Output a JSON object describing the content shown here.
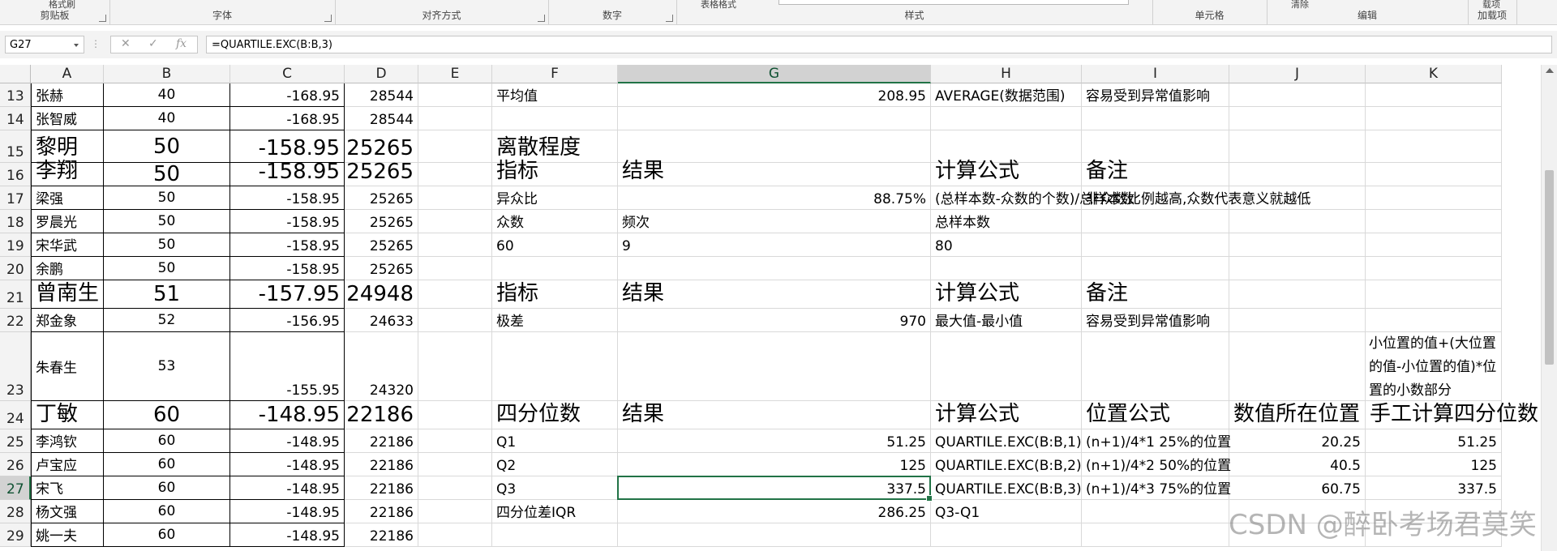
{
  "ribbon": {
    "groups": [
      "剪贴板",
      "字体",
      "对齐方式",
      "数字",
      "样式",
      "单元格",
      "编辑",
      "加载项"
    ],
    "fragments": {
      "paste_fmt": "格式刷",
      "table_fmt": "表格格式",
      "clear": "清除",
      "addins_top": "载项"
    }
  },
  "formula_bar": {
    "name_box": "G27",
    "cancel_icon": "✕",
    "enter_icon": "✓",
    "fx": "fx",
    "formula": "=QUARTILE.EXC(B:B,3)"
  },
  "columns": [
    "A",
    "B",
    "C",
    "D",
    "E",
    "F",
    "G",
    "H",
    "I",
    "J",
    "K"
  ],
  "selected_column": "G",
  "selected_row": "27",
  "rows": [
    {
      "num": "13",
      "A": "张赫",
      "B": "40",
      "C": "-168.95",
      "D": "28544",
      "F": "平均值",
      "G": "208.95",
      "H": "AVERAGE(数据范围)",
      "I": "容易受到异常值影响"
    },
    {
      "num": "14",
      "A": "张智威",
      "B": "40",
      "C": "-168.95",
      "D": "28544"
    },
    {
      "num": "15",
      "A": "黎明",
      "B": "50",
      "C": "-158.95",
      "D": "25265",
      "F": "离散程度"
    },
    {
      "num": "16",
      "A": "李翔",
      "B": "50",
      "C": "-158.95",
      "D": "25265",
      "F": "指标",
      "G": "结果",
      "H": "计算公式",
      "I": "备注"
    },
    {
      "num": "17",
      "A": "梁强",
      "B": "50",
      "C": "-158.95",
      "D": "25265",
      "F": "异众比",
      "G": "88.75%",
      "H": "(总样本数-众数的个数)/总样本数",
      "I": "非众数比例越高,众数代表意义就越低"
    },
    {
      "num": "18",
      "A": "罗晨光",
      "B": "50",
      "C": "-158.95",
      "D": "25265",
      "F": "众数",
      "G": "频次",
      "H": "总样本数"
    },
    {
      "num": "19",
      "A": "宋华武",
      "B": "50",
      "C": "-158.95",
      "D": "25265",
      "F": "60",
      "G": "9",
      "H": "80"
    },
    {
      "num": "20",
      "A": "余鹏",
      "B": "50",
      "C": "-158.95",
      "D": "25265"
    },
    {
      "num": "21",
      "A": "曾南生",
      "B": "51",
      "C": "-157.95",
      "D": "24948",
      "F": "指标",
      "G": "结果",
      "H": "计算公式",
      "I": "备注"
    },
    {
      "num": "22",
      "A": "郑金象",
      "B": "52",
      "C": "-156.95",
      "D": "24633",
      "F": "极差",
      "G": "970",
      "H": "最大值-最小值",
      "I": "容易受到异常值影响"
    },
    {
      "num": "23",
      "A": "朱春生",
      "B": "53",
      "C": "-155.95",
      "D": "24320",
      "K": "小位置的值+(大位置的值-小位置的值)*位置的小数部分"
    },
    {
      "num": "24",
      "A": "丁敏",
      "B": "60",
      "C": "-148.95",
      "D": "22186",
      "F": "四分位数",
      "G": "结果",
      "H": "计算公式",
      "I": "位置公式",
      "J": "数值所在位置",
      "K": "手工计算四分位数"
    },
    {
      "num": "25",
      "A": "李鸿钦",
      "B": "60",
      "C": "-148.95",
      "D": "22186",
      "F": "Q1",
      "G": "51.25",
      "H": "QUARTILE.EXC(B:B,1)",
      "I": "(n+1)/4*1   25%的位置",
      "J": "20.25",
      "K": "51.25"
    },
    {
      "num": "26",
      "A": "卢宝应",
      "B": "60",
      "C": "-148.95",
      "D": "22186",
      "F": "Q2",
      "G": "125",
      "H": "QUARTILE.EXC(B:B,2)",
      "I": "(n+1)/4*2   50%的位置",
      "J": "40.5",
      "K": "125"
    },
    {
      "num": "27",
      "A": "宋飞",
      "B": "60",
      "C": "-148.95",
      "D": "22186",
      "F": "Q3",
      "G": "337.5",
      "H": "QUARTILE.EXC(B:B,3)",
      "I": "(n+1)/4*3   75%的位置",
      "J": "60.75",
      "K": "337.5"
    },
    {
      "num": "28",
      "A": "杨文强",
      "B": "60",
      "C": "-148.95",
      "D": "22186",
      "F": "四分位差IQR",
      "G": "286.25",
      "H": "Q3-Q1"
    },
    {
      "num": "29",
      "A": "姚一夫",
      "B": "60",
      "C": "-148.95",
      "D": "22186"
    }
  ],
  "watermark": "CSDN @醉卧考场君莫笑",
  "accent_color": "#217346"
}
